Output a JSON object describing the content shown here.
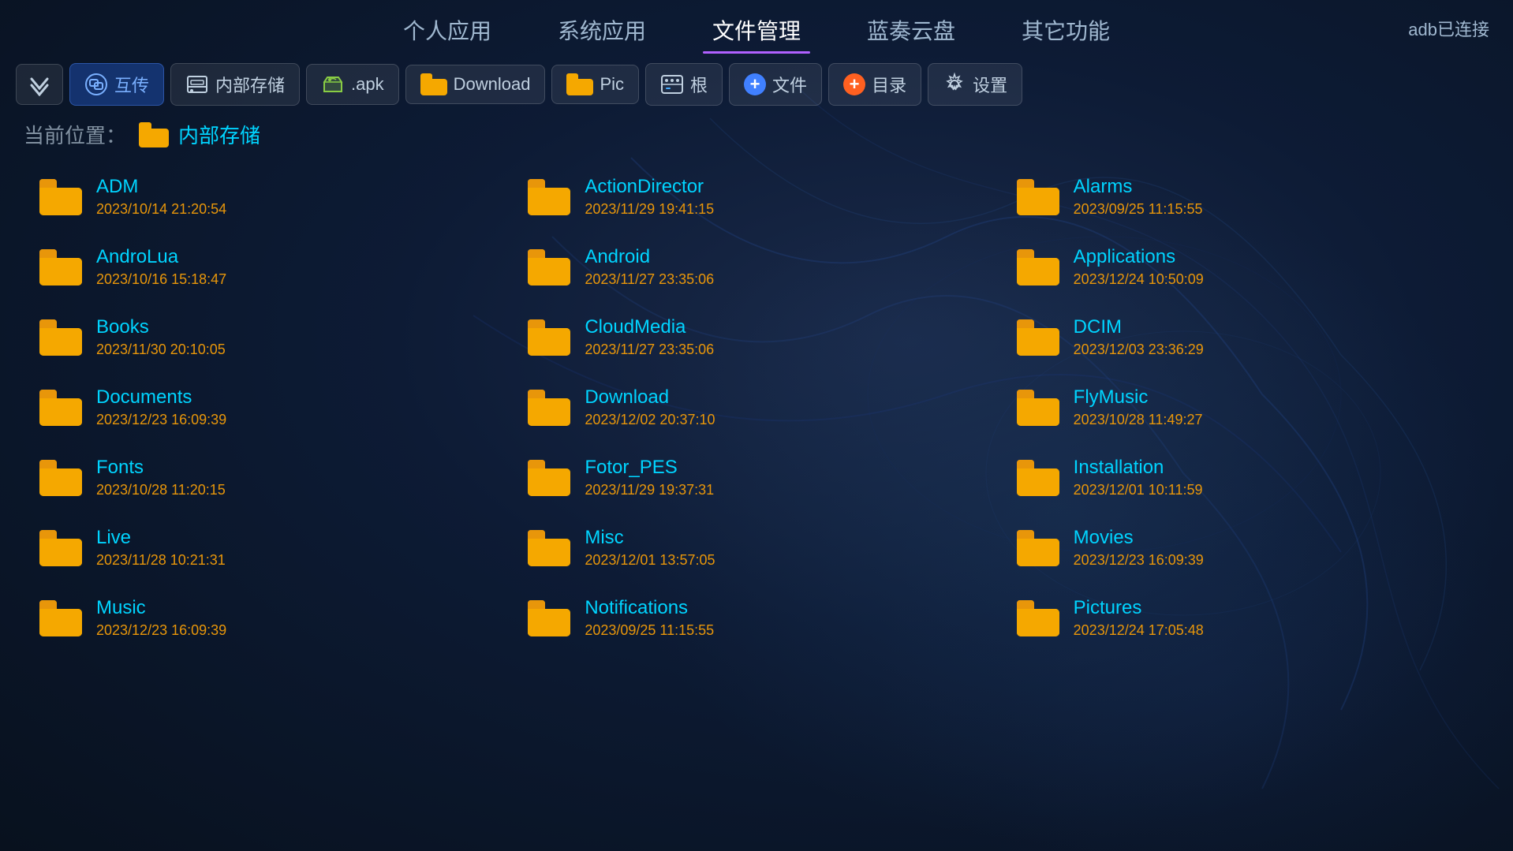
{
  "nav": {
    "items": [
      {
        "id": "personal-apps",
        "label": "个人应用",
        "active": false
      },
      {
        "id": "system-apps",
        "label": "系统应用",
        "active": false
      },
      {
        "id": "file-manager",
        "label": "文件管理",
        "active": true
      },
      {
        "id": "cloud-disk",
        "label": "蓝奏云盘",
        "active": false
      },
      {
        "id": "other-functions",
        "label": "其它功能",
        "active": false
      }
    ],
    "adb_status": "adb已连接"
  },
  "toolbar": {
    "buttons": [
      {
        "id": "collapse",
        "label": "",
        "icon": "chevron-down"
      },
      {
        "id": "mutual",
        "label": "互传",
        "icon": "mutual"
      },
      {
        "id": "internal-storage",
        "label": "内部存储",
        "icon": "storage"
      },
      {
        "id": "apk",
        "label": ".apk",
        "icon": "apk"
      },
      {
        "id": "download",
        "label": "Download",
        "icon": "folder"
      },
      {
        "id": "pic",
        "label": "Pic",
        "icon": "folder"
      },
      {
        "id": "root",
        "label": "根",
        "icon": "root"
      },
      {
        "id": "new-file",
        "label": "文件",
        "icon": "plus-blue"
      },
      {
        "id": "new-dir",
        "label": "目录",
        "icon": "plus-orange"
      },
      {
        "id": "settings",
        "label": "设置",
        "icon": "gear"
      }
    ]
  },
  "breadcrumb": {
    "label": "当前位置：",
    "path": "内部存储"
  },
  "files": [
    {
      "name": "ADM",
      "date": "2023/10/14 21:20:54"
    },
    {
      "name": "ActionDirector",
      "date": "2023/11/29 19:41:15"
    },
    {
      "name": "Alarms",
      "date": "2023/09/25 11:15:55"
    },
    {
      "name": "AndroLua",
      "date": "2023/10/16 15:18:47"
    },
    {
      "name": "Android",
      "date": "2023/11/27 23:35:06"
    },
    {
      "name": "Applications",
      "date": "2023/12/24 10:50:09"
    },
    {
      "name": "Books",
      "date": "2023/11/30 20:10:05"
    },
    {
      "name": "CloudMedia",
      "date": "2023/11/27 23:35:06"
    },
    {
      "name": "DCIM",
      "date": "2023/12/03 23:36:29"
    },
    {
      "name": "Documents",
      "date": "2023/12/23 16:09:39"
    },
    {
      "name": "Download",
      "date": "2023/12/02 20:37:10"
    },
    {
      "name": "FlyMusic",
      "date": "2023/10/28 11:49:27"
    },
    {
      "name": "Fonts",
      "date": "2023/10/28 11:20:15"
    },
    {
      "name": "Fotor_PES",
      "date": "2023/11/29 19:37:31"
    },
    {
      "name": "Installation",
      "date": "2023/12/01 10:11:59"
    },
    {
      "name": "Live",
      "date": "2023/11/28 10:21:31"
    },
    {
      "name": "Misc",
      "date": "2023/12/01 13:57:05"
    },
    {
      "name": "Movies",
      "date": "2023/12/23 16:09:39"
    },
    {
      "name": "Music",
      "date": "2023/12/23 16:09:39"
    },
    {
      "name": "Notifications",
      "date": "2023/09/25 11:15:55"
    },
    {
      "name": "Pictures",
      "date": "2023/12/24 17:05:48"
    }
  ]
}
